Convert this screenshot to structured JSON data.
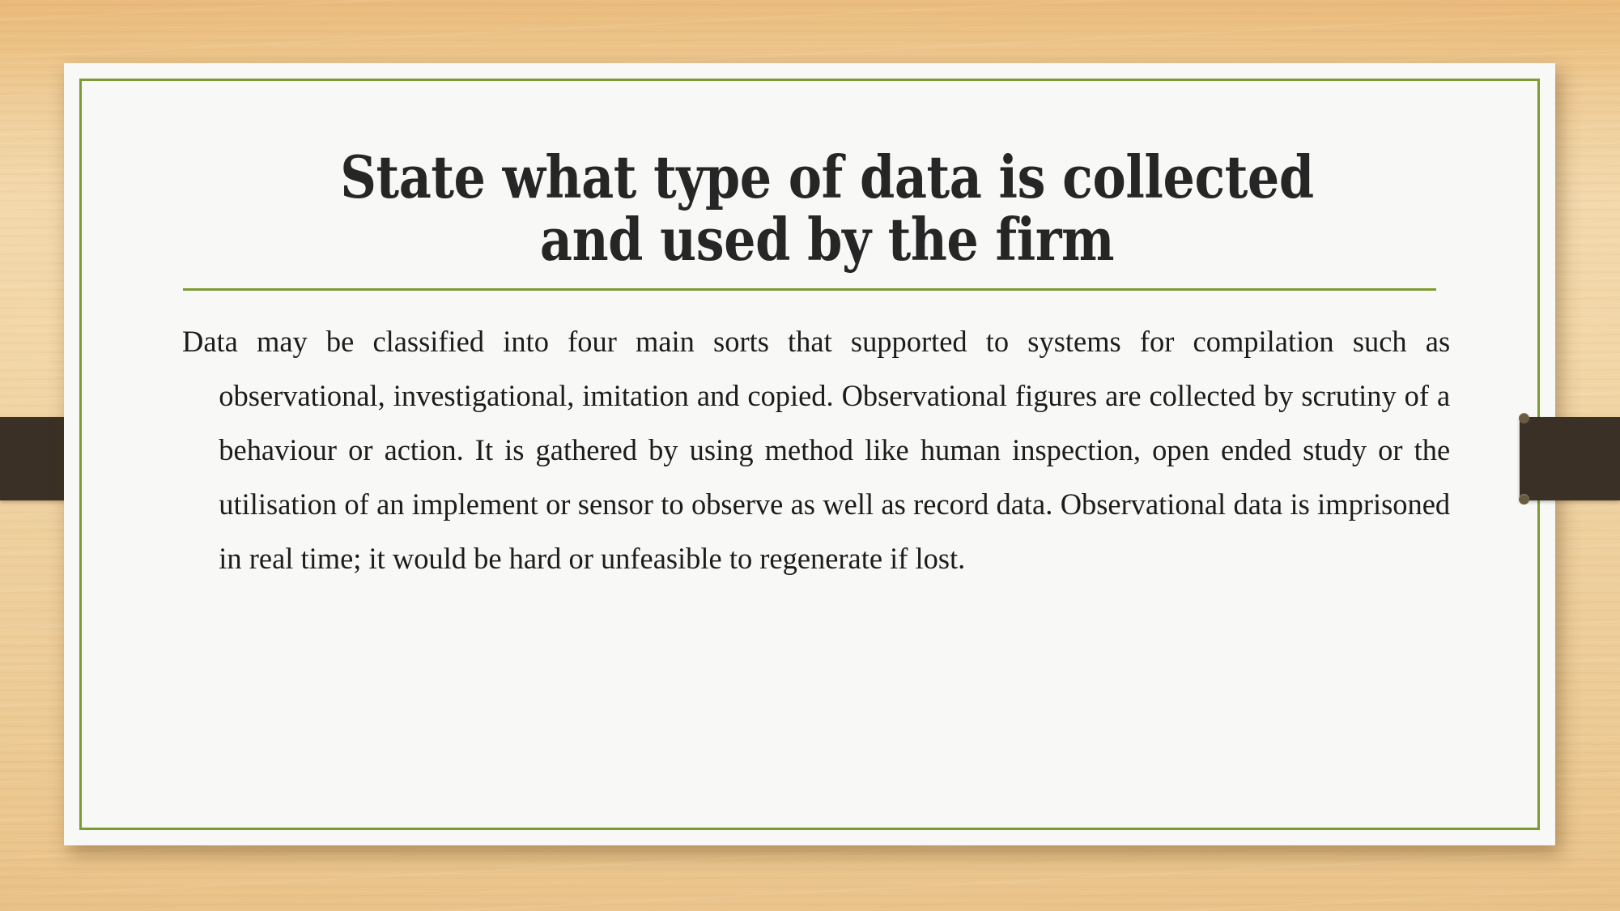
{
  "slide": {
    "title": "State what type of data is collected and used by the firm",
    "body": "Data may be classified into four main sorts that supported to systems for compilation such as observational, investigational, imitation and copied. Observational figures are collected by scrutiny of a behaviour or action. It is gathered by using method like human inspection, open ended study or the utilisation of an implement or sensor to observe as well as record data. Observational data is imprisoned in real time; it would be hard or unfeasible to regenerate if lost."
  },
  "theme": {
    "accent_green": "#7d9a33",
    "ribbon_brown": "#3a3026",
    "ribbon_knob": "#6a5a3f",
    "card_background": "#f8f8f6",
    "title_color": "#262626",
    "body_color": "#1c1c1c",
    "wood_top": "#e9b877",
    "wood_mid": "#f2d7a8",
    "wood_bottom": "#e9c288"
  }
}
